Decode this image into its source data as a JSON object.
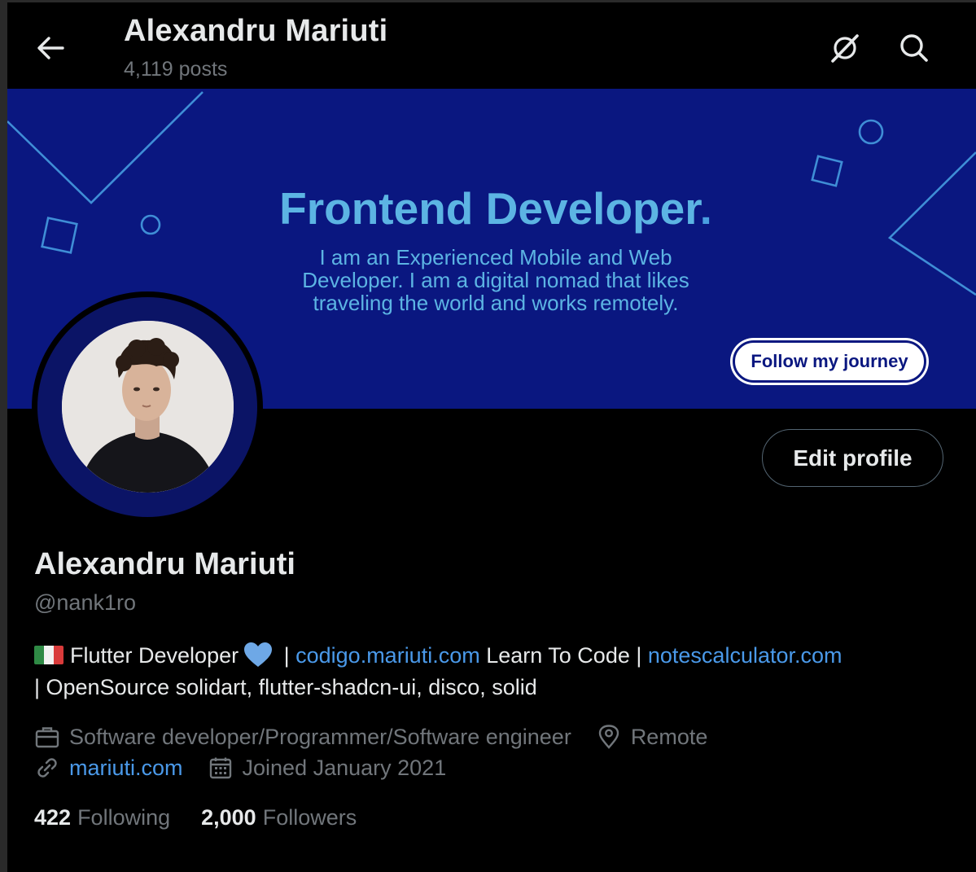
{
  "header": {
    "title": "Alexandru Mariuti",
    "posts": "4,119 posts"
  },
  "banner": {
    "heading": "Frontend Developer",
    "heading_dot": ".",
    "lines": [
      "I am an Experienced Mobile and Web",
      "Developer. I am a digital nomad that likes",
      "traveling the world and works remotely."
    ],
    "cta": "Follow my journey"
  },
  "profile": {
    "edit_button": "Edit profile",
    "name": "Alexandru Mariuti",
    "handle": "@nank1ro",
    "bio": {
      "part1": "Flutter Developer",
      "sep1": " | ",
      "link1": "codigo.mariuti.com",
      "part2": " Learn To Code | ",
      "link2": "notescalculator.com",
      "part3": "| OpenSource solidart, flutter-shadcn-ui, disco, solid"
    },
    "category": "Software developer/Programmer/Software engineer",
    "location": "Remote",
    "website": "mariuti.com",
    "joined": "Joined January 2021",
    "following_count": "422",
    "following_label": "Following",
    "followers_count": "2,000",
    "followers_label": "Followers"
  },
  "colors": {
    "background": "#000000",
    "banner": "#0a1780",
    "banner_text": "#5cb4e3",
    "link": "#4a99e9",
    "muted": "#71767b"
  },
  "icons": [
    "back-arrow-icon",
    "grok-icon",
    "search-icon",
    "briefcase-icon",
    "location-pin-icon",
    "link-icon",
    "calendar-icon",
    "heart-icon",
    "italy-flag-icon"
  ]
}
